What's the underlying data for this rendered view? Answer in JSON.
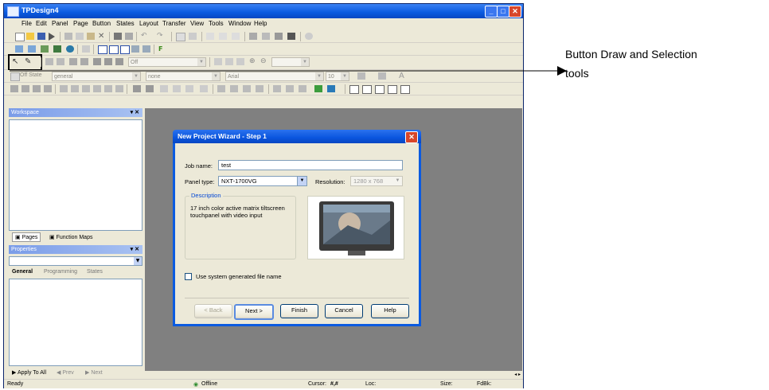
{
  "window": {
    "title": "TPDesign4",
    "min_label": "_",
    "max_label": "□",
    "close_label": "✕"
  },
  "menu": [
    "File",
    "Edit",
    "Panel",
    "Page",
    "Button",
    "States",
    "Layout",
    "Transfer",
    "View",
    "Tools",
    "Window",
    "Help"
  ],
  "toolbar_states": {
    "state_label": "Off State",
    "general": "general",
    "none": "none",
    "font": "Arial",
    "size": "10",
    "off": "Off"
  },
  "workspace": {
    "title": "Workspace",
    "tabs": [
      "Pages",
      "Function Maps"
    ]
  },
  "properties": {
    "title": "Properties",
    "tabs": [
      "General",
      "Programming",
      "States"
    ]
  },
  "bottom_nav": {
    "apply": "Apply To All",
    "prev": "Prev",
    "next": "Next"
  },
  "status": {
    "ready": "Ready",
    "offline": "Offline",
    "cursor": "Cursor:",
    "cursor_val": "#,#",
    "loc": "Loc:",
    "size": "Size:",
    "fdbk": "FdBk:"
  },
  "dialog": {
    "title": "New Project Wizard - Step 1",
    "job_label": "Job name:",
    "job_value": "test",
    "panel_label": "Panel type:",
    "panel_value": "NXT-1700VG",
    "res_label": "Resolution:",
    "res_value": "1280 x 768",
    "desc_legend": "Description",
    "desc_text": "17 inch color active matrix tiltscreen touchpanel with video input",
    "checkbox_label": "Use system generated file name",
    "buttons": {
      "back": "< Back",
      "next": "Next >",
      "finish": "Finish",
      "cancel": "Cancel",
      "help": "Help"
    }
  },
  "callout": {
    "line1": "Button Draw and Selection",
    "line2": "tools"
  },
  "colors": {
    "accent": "#0a5ae0",
    "canvas": "#808080",
    "panel_bg": "#ece9d8"
  }
}
